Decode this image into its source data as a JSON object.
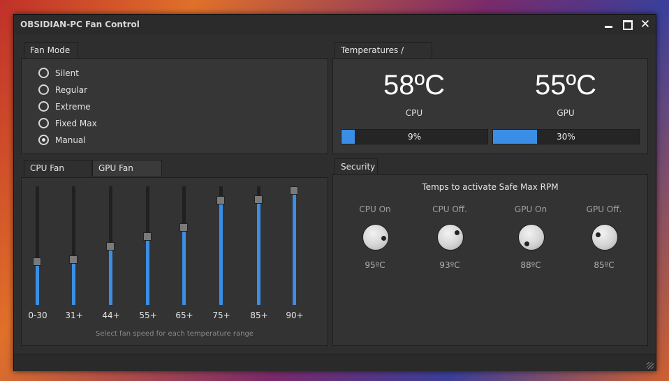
{
  "window": {
    "title": "OBSIDIAN-PC Fan Control"
  },
  "fan_mode": {
    "tab_label": "Fan Mode",
    "options": [
      {
        "label": "Silent",
        "checked": false
      },
      {
        "label": "Regular",
        "checked": false
      },
      {
        "label": "Extreme",
        "checked": false
      },
      {
        "label": "Fixed Max",
        "checked": false
      },
      {
        "label": "Manual",
        "checked": true
      }
    ]
  },
  "fan_tables": {
    "tabs": [
      "CPU Fan Table",
      "GPU Fan Table"
    ],
    "active_tab": "CPU Fan Table",
    "sliders": [
      {
        "label": "0-30",
        "level": 0.36
      },
      {
        "label": "31+",
        "level": 0.38
      },
      {
        "label": "44+",
        "level": 0.5
      },
      {
        "label": "55+",
        "level": 0.59
      },
      {
        "label": "65+",
        "level": 0.67
      },
      {
        "label": "75+",
        "level": 0.91
      },
      {
        "label": "85+",
        "level": 0.92
      },
      {
        "label": "90+",
        "level": 1.0
      }
    ],
    "hint": "Select fan speed for each temperature range"
  },
  "temps": {
    "tab_label": "Temperatures / Load",
    "cpu": {
      "temp": "58ºC",
      "label": "CPU",
      "load_text": "9%",
      "load": 0.09
    },
    "gpu": {
      "temp": "55ºC",
      "label": "GPU",
      "load_text": "30%",
      "load": 0.3
    }
  },
  "security": {
    "tab_label": "Security",
    "title": "Temps to activate Safe Max RPM",
    "knobs": [
      {
        "label": "CPU On",
        "value": "95ºC"
      },
      {
        "label": "CPU Off.",
        "value": "93ºC"
      },
      {
        "label": "GPU On",
        "value": "88ºC"
      },
      {
        "label": "GPU Off.",
        "value": "85ºC"
      }
    ]
  },
  "colors": {
    "accent": "#3a8ee6",
    "window_bg": "#2e2e2e"
  }
}
